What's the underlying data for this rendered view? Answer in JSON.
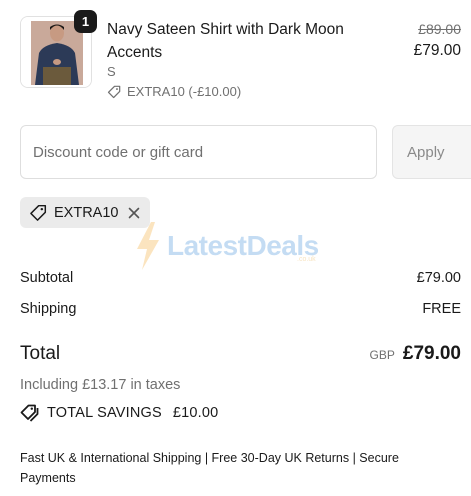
{
  "product": {
    "quantity": "1",
    "title": "Navy Sateen Shirt with Dark Moon Accents",
    "variant": "S",
    "discount_label": "EXTRA10 (-£10.00)",
    "original_price": "£89.00",
    "price": "£79.00",
    "image_icon": "product-photo-man-in-navy-shirt"
  },
  "discount_form": {
    "placeholder": "Discount code or gift card",
    "value": "",
    "apply_label": "Apply"
  },
  "applied_code": {
    "code": "EXTRA10",
    "tag_icon": "tag-icon",
    "remove_icon": "close-icon"
  },
  "watermark": {
    "text": "LatestDeals",
    "sub": ".co.uk"
  },
  "summary": {
    "subtotal_label": "Subtotal",
    "subtotal_value": "£79.00",
    "shipping_label": "Shipping",
    "shipping_value": "FREE",
    "total_label": "Total",
    "currency": "GBP",
    "total_value": "£79.00",
    "taxes_text": "Including £13.17 in taxes",
    "savings_label": "TOTAL SAVINGS",
    "savings_value": "£10.00"
  },
  "footer": {
    "text": "Fast UK & International Shipping | Free 30-Day UK Returns | Secure Payments"
  },
  "colors": {
    "text": "#1a1a1a",
    "muted": "#707070",
    "chip_bg": "#ebebeb",
    "badge_bg": "#1a1a1a"
  }
}
